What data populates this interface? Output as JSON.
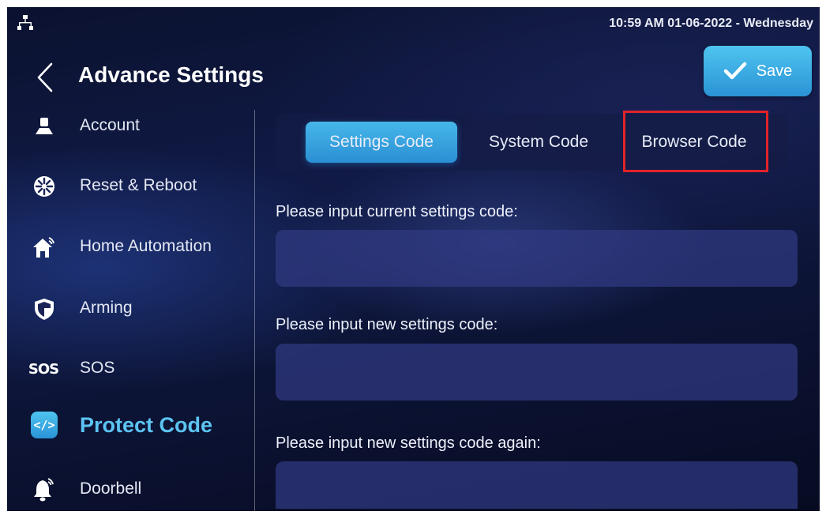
{
  "status_bar": {
    "datetime": "10:59 AM  01-06-2022 - Wednesday",
    "network_icon": "network-icon"
  },
  "header": {
    "title": "Advance Settings",
    "back_icon": "chevron-left-icon",
    "save_label": "Save",
    "save_icon": "check-icon"
  },
  "sidebar": {
    "items": [
      {
        "label": "Account",
        "icon": "account-icon"
      },
      {
        "label": "Reset & Reboot",
        "icon": "reset-icon"
      },
      {
        "label": "Home Automation",
        "icon": "home-automation-icon"
      },
      {
        "label": "Arming",
        "icon": "shield-icon"
      },
      {
        "label": "SOS",
        "icon": "sos-icon",
        "icon_text": "SOS"
      },
      {
        "label": "Protect Code",
        "icon": "code-icon",
        "icon_text": "</>",
        "active": true
      },
      {
        "label": "Doorbell",
        "icon": "bell-icon"
      }
    ]
  },
  "tabs": [
    {
      "label": "Settings Code",
      "active": true
    },
    {
      "label": "System Code",
      "active": false
    },
    {
      "label": "Browser Code",
      "active": false,
      "highlighted": true
    }
  ],
  "form": {
    "current_label": "Please input current settings code:",
    "current_value": "",
    "new_label": "Please input new settings code:",
    "new_value": "",
    "again_label": "Please input new settings code again:",
    "again_value": ""
  },
  "colors": {
    "accent": "#46b7ea",
    "active_text": "#5cc4f2",
    "highlight": "#e3232a"
  }
}
